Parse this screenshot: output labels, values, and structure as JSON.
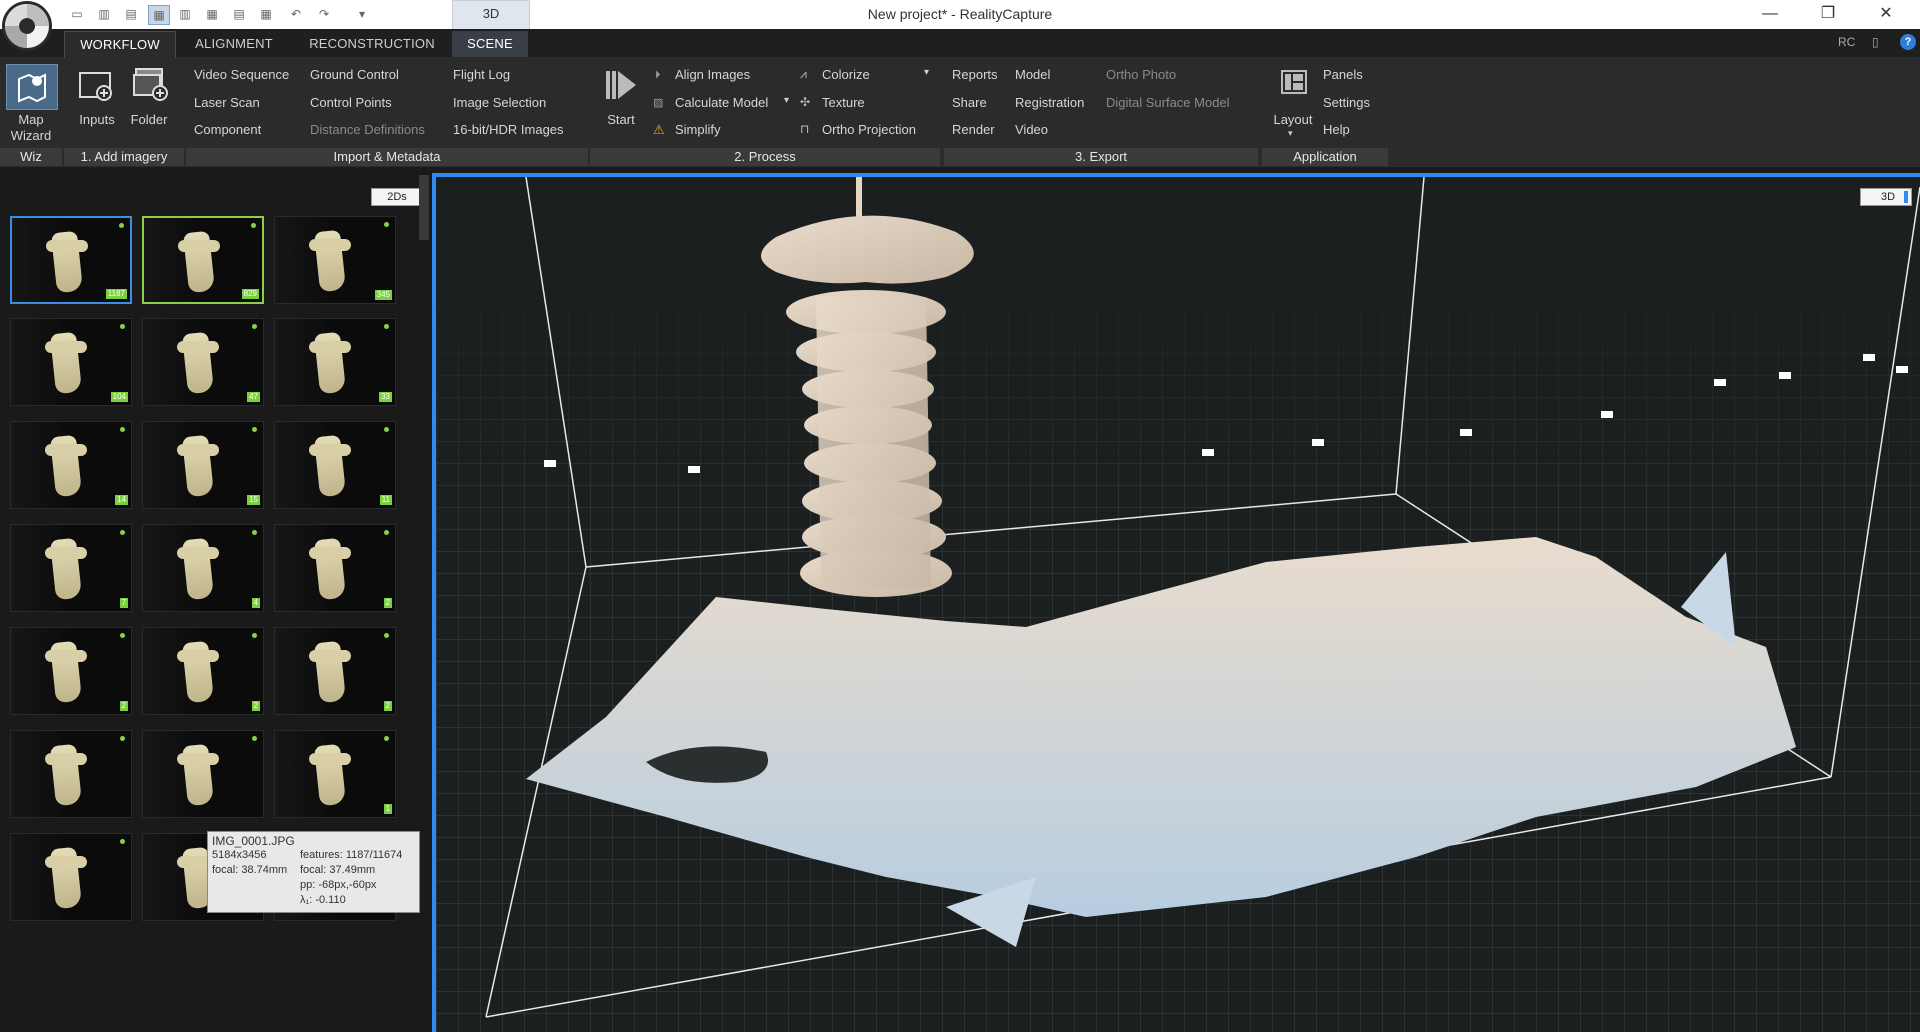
{
  "window": {
    "title": "New project* - RealityCapture",
    "mode_button": "3D",
    "controls": {
      "minimize": "—",
      "maximize": "❐",
      "close": "✕"
    }
  },
  "tabs": [
    {
      "label": "WORKFLOW",
      "selected": true
    },
    {
      "label": "ALIGNMENT",
      "selected": false
    },
    {
      "label": "RECONSTRUCTION",
      "selected": false
    },
    {
      "label": "SCENE",
      "selected": false
    }
  ],
  "top_right": {
    "rc": "RC",
    "help": "?"
  },
  "ribbon": {
    "wiz": {
      "map_wizard_line1": "Map",
      "map_wizard_line2": "Wizard",
      "group": "Wiz"
    },
    "add_imagery": {
      "inputs": "Inputs",
      "folder": "Folder",
      "group": "1. Add imagery"
    },
    "import": {
      "col1": [
        "Video Sequence",
        "Laser Scan",
        "Component"
      ],
      "col2": [
        "Ground Control",
        "Control Points",
        "Distance Definitions"
      ],
      "col3": [
        "Flight Log",
        "Image Selection",
        "16-bit/HDR Images"
      ],
      "group": "Import & Metadata"
    },
    "process": {
      "start": "Start",
      "col1": [
        "Align Images",
        "Calculate Model",
        "Simplify"
      ],
      "col2": [
        "Colorize",
        "Texture",
        "Ortho Projection"
      ],
      "group": "2. Process"
    },
    "export": {
      "col1": [
        "Reports",
        "Share",
        "Render"
      ],
      "col2": [
        "Model",
        "Registration",
        "Video"
      ],
      "col3": [
        "Ortho Photo",
        "Digital Surface Model"
      ],
      "group": "3. Export"
    },
    "application": {
      "layout": "Layout",
      "col": [
        "Panels",
        "Settings",
        "Help"
      ],
      "group": "Application"
    }
  },
  "panel_2d": {
    "badge": "2Ds",
    "thumbnails": [
      {
        "count": "1187"
      },
      {
        "count": "829"
      },
      {
        "count": "345"
      },
      {
        "count": "104"
      },
      {
        "count": "47"
      },
      {
        "count": "33"
      },
      {
        "count": "14"
      },
      {
        "count": "15"
      },
      {
        "count": "11"
      },
      {
        "count": "7"
      },
      {
        "count": "4"
      },
      {
        "count": "2"
      },
      {
        "count": "2"
      },
      {
        "count": "2"
      },
      {
        "count": "2"
      },
      {
        "count": ""
      },
      {
        "count": ""
      },
      {
        "count": "1"
      },
      {
        "count": ""
      },
      {
        "count": ""
      },
      {
        "count": ""
      }
    ],
    "tooltip": {
      "name": "IMG_0001.JPG",
      "resolution": "5184x3456",
      "focal_exif": "focal: 38.74mm",
      "features": "features: 1187/11674",
      "focal": "focal: 37.49mm",
      "pp": "pp: -68px,-60px",
      "lambda": "λ₁: -0.110"
    }
  },
  "viewport_3d": {
    "badge": "3D"
  },
  "colors": {
    "accent": "#2d8cf0",
    "selected_green": "#8ad04a",
    "model": "#e6d7c3"
  }
}
